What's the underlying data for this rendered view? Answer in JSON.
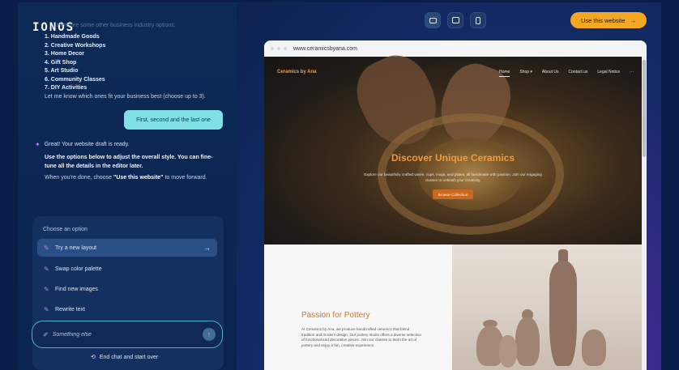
{
  "brand": {
    "logo": "IONOS"
  },
  "chat": {
    "faded_top": "Here are some other business industry options:",
    "business_options": [
      "1. Handmade Goods",
      "2. Creative Workshops",
      "3. Home Decor",
      "4. Gift Shop",
      "5. Art Studio",
      "6. Community Classes",
      "7. DIY Activities"
    ],
    "ask": "Let me know which ones fit your business best (choose up to 3).",
    "user_reply": "First, second and the last one",
    "bot_ready": "Great! Your website draft is ready.",
    "bot_adjust": "Use the options below to adjust the overall style. You can fine-tune all the details in the editor later.",
    "bot_done_prefix": "When you're done, choose ",
    "bot_done_highlight": "\"Use this website\"",
    "bot_done_suffix": " to move forward."
  },
  "options": {
    "title": "Choose an option",
    "items": [
      {
        "label": "Try a new layout"
      },
      {
        "label": "Swap color palette"
      },
      {
        "label": "Find new images"
      },
      {
        "label": "Rewrite text"
      }
    ],
    "input_placeholder": "Something else",
    "end_chat": "End chat and start over"
  },
  "toolbar": {
    "use_website": "Use this website",
    "devices": [
      "desktop-icon",
      "tablet-icon",
      "mobile-icon"
    ]
  },
  "preview": {
    "url": "www.ceramicsbyana.com",
    "site_brand": "Ceramics by Ana",
    "nav": [
      "Home",
      "Shop ▾",
      "About Us",
      "Contact us",
      "Legal Notice",
      "···"
    ],
    "hero_title": "Discover Unique Ceramics",
    "hero_sub": "Explore our beautifully crafted vases, cups, mugs, and plates, all handmade with passion. Join our engaging classes to unleash your creativity.",
    "hero_button": "Browse Collection",
    "section_title": "Passion for Pottery",
    "section_text": "At Ceramics by Ana, we produce handcrafted ceramics that blend tradition and modern design. Our pottery studio offers a diverse selection of functional and decorative pieces. Join our classes to learn the art of pottery and enjoy a fun, creative experience."
  },
  "colors": {
    "accent_orange": "#f5a623",
    "user_bubble": "#7fe0e6",
    "panel_bg": "#0d2a57"
  }
}
